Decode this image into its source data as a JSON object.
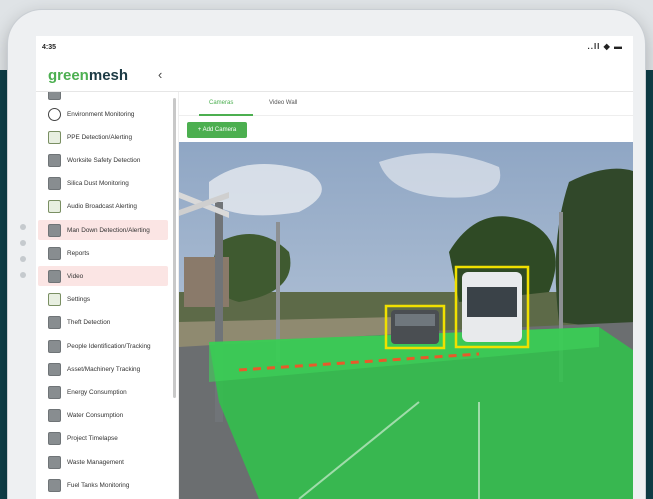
{
  "status": {
    "time": "4:35",
    "system": "..ll ◆ ▬"
  },
  "brand": {
    "name_green": "green",
    "name_dark": "mesh",
    "collapse_icon": "chevron-left-icon"
  },
  "sidebar": {
    "items": [
      {
        "label": "Environment Monitoring",
        "icon": "circle-icon",
        "highlight": false
      },
      {
        "label": "PPE Detection/Alerting",
        "icon": "ppe-icon",
        "highlight": false
      },
      {
        "label": "Worksite Safety Detection",
        "icon": "module-icon",
        "highlight": false
      },
      {
        "label": "Silica Dust Monitoring",
        "icon": "module-icon",
        "highlight": false
      },
      {
        "label": "Audio Broadcast Alerting",
        "icon": "ppe-icon",
        "highlight": false
      },
      {
        "label": "Man Down Detection/Alerting",
        "icon": "module-icon",
        "highlight": true
      },
      {
        "label": "Reports",
        "icon": "module-icon",
        "highlight": false
      },
      {
        "label": "Video",
        "icon": "video-icon",
        "highlight": true
      },
      {
        "label": "Settings",
        "icon": "gear-icon",
        "highlight": false
      },
      {
        "label": "Theft Detection",
        "icon": "module-icon",
        "highlight": false
      },
      {
        "label": "People Identification/Tracking",
        "icon": "module-icon",
        "highlight": false
      },
      {
        "label": "Asset/Machinery Tracking",
        "icon": "module-icon",
        "highlight": false
      },
      {
        "label": "Energy Consumption",
        "icon": "module-icon",
        "highlight": false
      },
      {
        "label": "Water Consumption",
        "icon": "module-icon",
        "highlight": false
      },
      {
        "label": "Project Timelapse",
        "icon": "module-icon",
        "highlight": false
      },
      {
        "label": "Waste Management",
        "icon": "module-icon",
        "highlight": false
      },
      {
        "label": "Fuel Tanks Monitoring",
        "icon": "module-icon",
        "highlight": false
      }
    ]
  },
  "tabs": [
    {
      "label": "Cameras",
      "active": true
    },
    {
      "label": "Video Wall",
      "active": false
    }
  ],
  "toolbar": {
    "add_camera": "+ Add Camera"
  },
  "colors": {
    "accent": "#4caf50",
    "detection_box": "#f0e000",
    "zone_fill": "#2fc44a"
  }
}
